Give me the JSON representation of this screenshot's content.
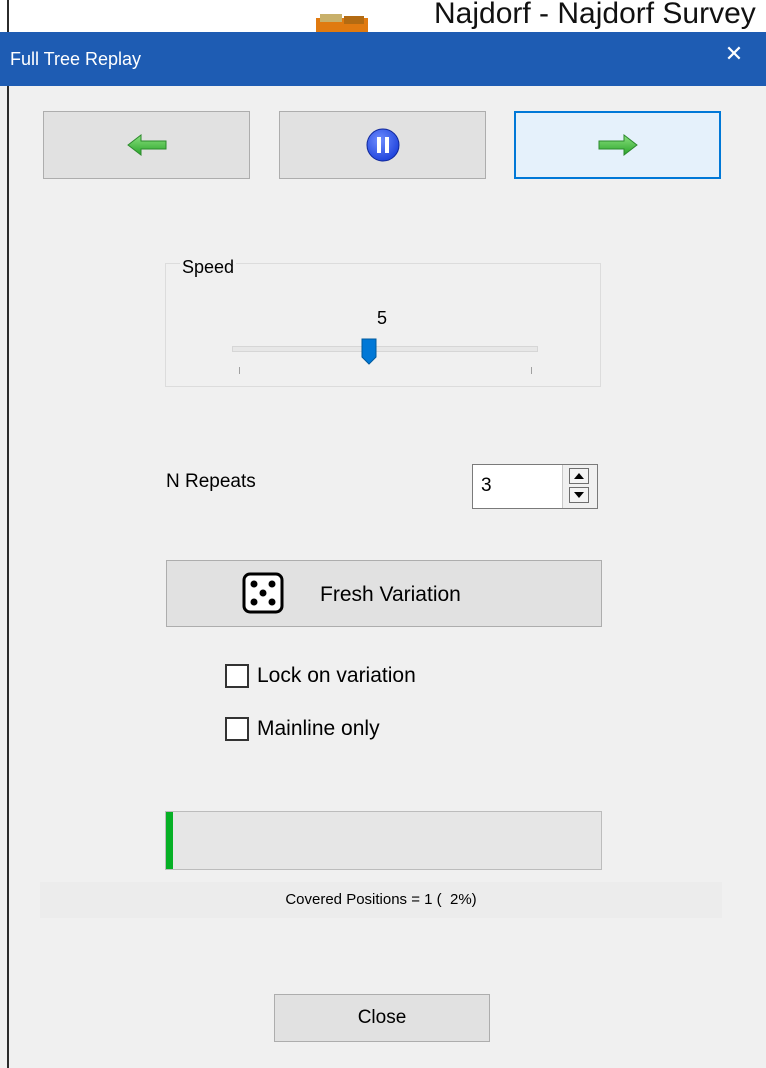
{
  "background_window": {
    "title": "Najdorf - Najdorf Survey",
    "icon": "book-stack-icon"
  },
  "dialog": {
    "title": "Full Tree Replay",
    "close_glyph": "✕"
  },
  "nav": {
    "back_icon": "left-arrow-icon",
    "pause_icon": "pause-icon",
    "forward_icon": "right-arrow-icon",
    "arrow_color": "#3cbf3a",
    "pause_color": "#1a3fd9"
  },
  "speed": {
    "label": "Speed",
    "value": "5",
    "slider_fraction": 0.45
  },
  "repeats": {
    "label": "N Repeats",
    "value": "3"
  },
  "fresh_variation": {
    "label": "Fresh Variation",
    "icon": "dice-icon"
  },
  "options": {
    "lock_label": "Lock on variation",
    "lock_checked": false,
    "mainline_label": "Mainline only",
    "mainline_checked": false
  },
  "progress": {
    "fraction": 0.02,
    "fill_color": "#06b025",
    "covered_text": "Covered Positions = 1 (  2%)"
  },
  "footer": {
    "close_label": "Close"
  }
}
